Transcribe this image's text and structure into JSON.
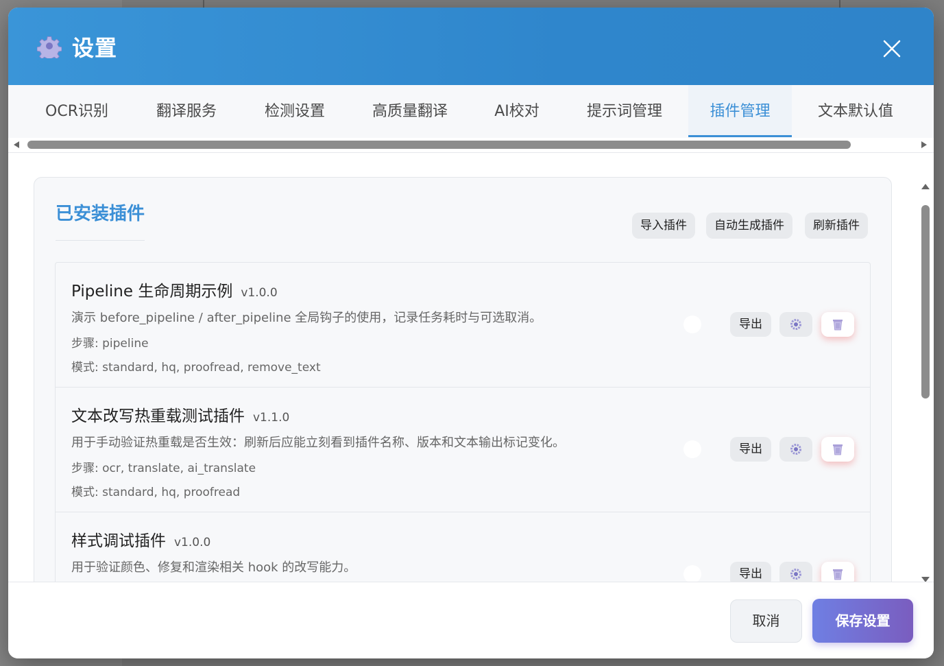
{
  "dialog": {
    "title": "设置"
  },
  "tabs": [
    {
      "label": "OCR识别"
    },
    {
      "label": "翻译服务"
    },
    {
      "label": "检测设置"
    },
    {
      "label": "高质量翻译"
    },
    {
      "label": "AI校对"
    },
    {
      "label": "提示词管理"
    },
    {
      "label": "插件管理",
      "active": true
    },
    {
      "label": "文本默认值"
    }
  ],
  "panel": {
    "title": "已安装插件",
    "actions": {
      "import": "导入插件",
      "autogen": "自动生成插件",
      "refresh": "刷新插件"
    }
  },
  "plugins": [
    {
      "name": "Pipeline 生命周期示例",
      "version": "v1.0.0",
      "description": "演示 before_pipeline / after_pipeline 全局钩子的使用，记录任务耗时与可选取消。",
      "steps": "步骤: pipeline",
      "modes": "模式: standard, hq, proofread, remove_text",
      "export": "导出"
    },
    {
      "name": "文本改写热重载测试插件",
      "version": "v1.1.0",
      "description": "用于手动验证热重载是否生效：刷新后应能立刻看到插件名称、版本和文本输出标记变化。",
      "steps": "步骤: ocr, translate, ai_translate",
      "modes": "模式: standard, hq, proofread",
      "export": "导出"
    },
    {
      "name": "样式调试插件",
      "version": "v1.0.0",
      "description": "用于验证颜色、修复和渲染相关 hook 的改写能力。",
      "export": "导出"
    }
  ],
  "footer": {
    "cancel": "取消",
    "save": "保存设置"
  },
  "colors": {
    "accent": "#3b8fd6",
    "header": "#3a95d8",
    "save_start": "#6f7fe3",
    "save_end": "#7a5dbf"
  },
  "icons": {
    "header": "gear-icon",
    "close": "close-icon",
    "plugin_settings": "gear-icon",
    "plugin_delete": "trash-icon"
  }
}
